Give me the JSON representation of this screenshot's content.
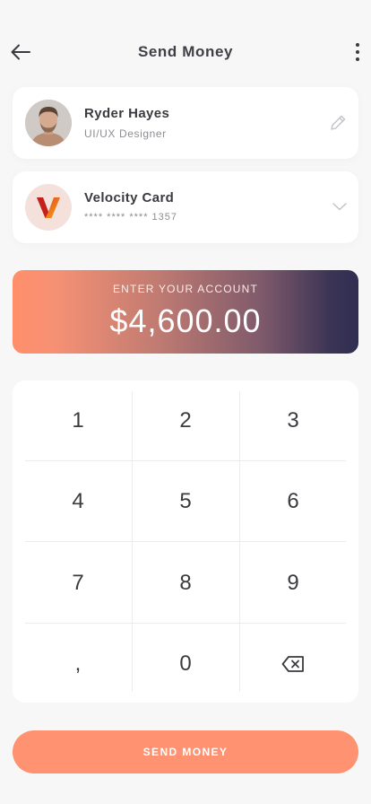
{
  "header": {
    "title": "Send Money",
    "back_icon": "arrow-left-icon",
    "more_icon": "more-vertical-icon"
  },
  "recipient": {
    "name": "Ryder Hayes",
    "role": "UI/UX Designer",
    "edit_icon": "pencil-icon"
  },
  "payment_card": {
    "name": "Velocity Card",
    "number": "**** **** **** 1357",
    "logo_letter": "V",
    "dropdown_icon": "chevron-down-icon"
  },
  "amount": {
    "label": "ENTER YOUR ACCOUNT",
    "value": "$4,600.00"
  },
  "keypad": {
    "keys": [
      "1",
      "2",
      "3",
      "4",
      "5",
      "6",
      "7",
      "8",
      "9",
      ",",
      "0",
      "⌫"
    ]
  },
  "send_button": {
    "label": "SEND MONEY"
  },
  "colors": {
    "accent": "#ff9270",
    "gradient_start": "#ff8f6b",
    "gradient_end": "#302e52",
    "background": "#f7f7f8"
  }
}
